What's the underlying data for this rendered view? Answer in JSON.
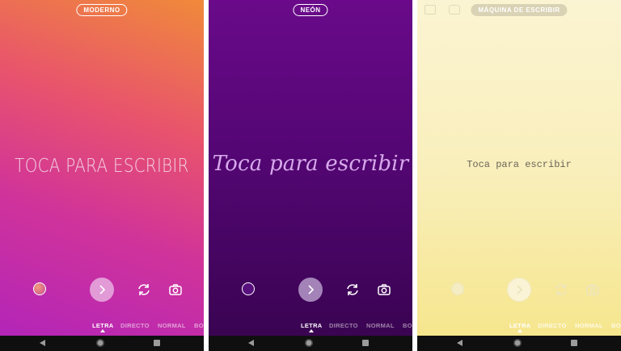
{
  "panels": [
    {
      "style_label": "MODERNO",
      "prompt": "TOCA PARA ESCRIBIR",
      "tabs": [
        "LETRA",
        "DIRECTO",
        "NORMAL",
        "BO"
      ],
      "active_tab": "LETRA"
    },
    {
      "style_label": "NEÓN",
      "prompt": "Toca para escribir",
      "tabs": [
        "LETRA",
        "DIRECTO",
        "NORMAL",
        "BO"
      ],
      "active_tab": "LETRA"
    },
    {
      "style_label": "MÁQUINA DE ESCRIBIR",
      "prompt": "Toca para escribir",
      "tabs": [
        "LETRA",
        "DIRECTO",
        "NORMAL",
        "BO"
      ],
      "active_tab": "LETRA"
    }
  ],
  "icons": {
    "color": "color-picker-icon",
    "next": "chevron-right-icon",
    "flip": "flip-camera-icon",
    "camera": "camera-icon",
    "nav_back": "back-triangle-icon",
    "nav_home": "home-circle-icon",
    "nav_recent": "recent-apps-square-icon"
  },
  "colors": {
    "moderno_gradient": [
      "#f08a3a",
      "#e8536d",
      "#d0339a",
      "#b325b8"
    ],
    "neon_gradient": [
      "#6a0a8a",
      "#540674",
      "#3a0452"
    ],
    "maquina_gradient": [
      "#fbf4d2",
      "#f9efbc",
      "#f6e68e"
    ],
    "navbar": "#0f0f0f"
  }
}
